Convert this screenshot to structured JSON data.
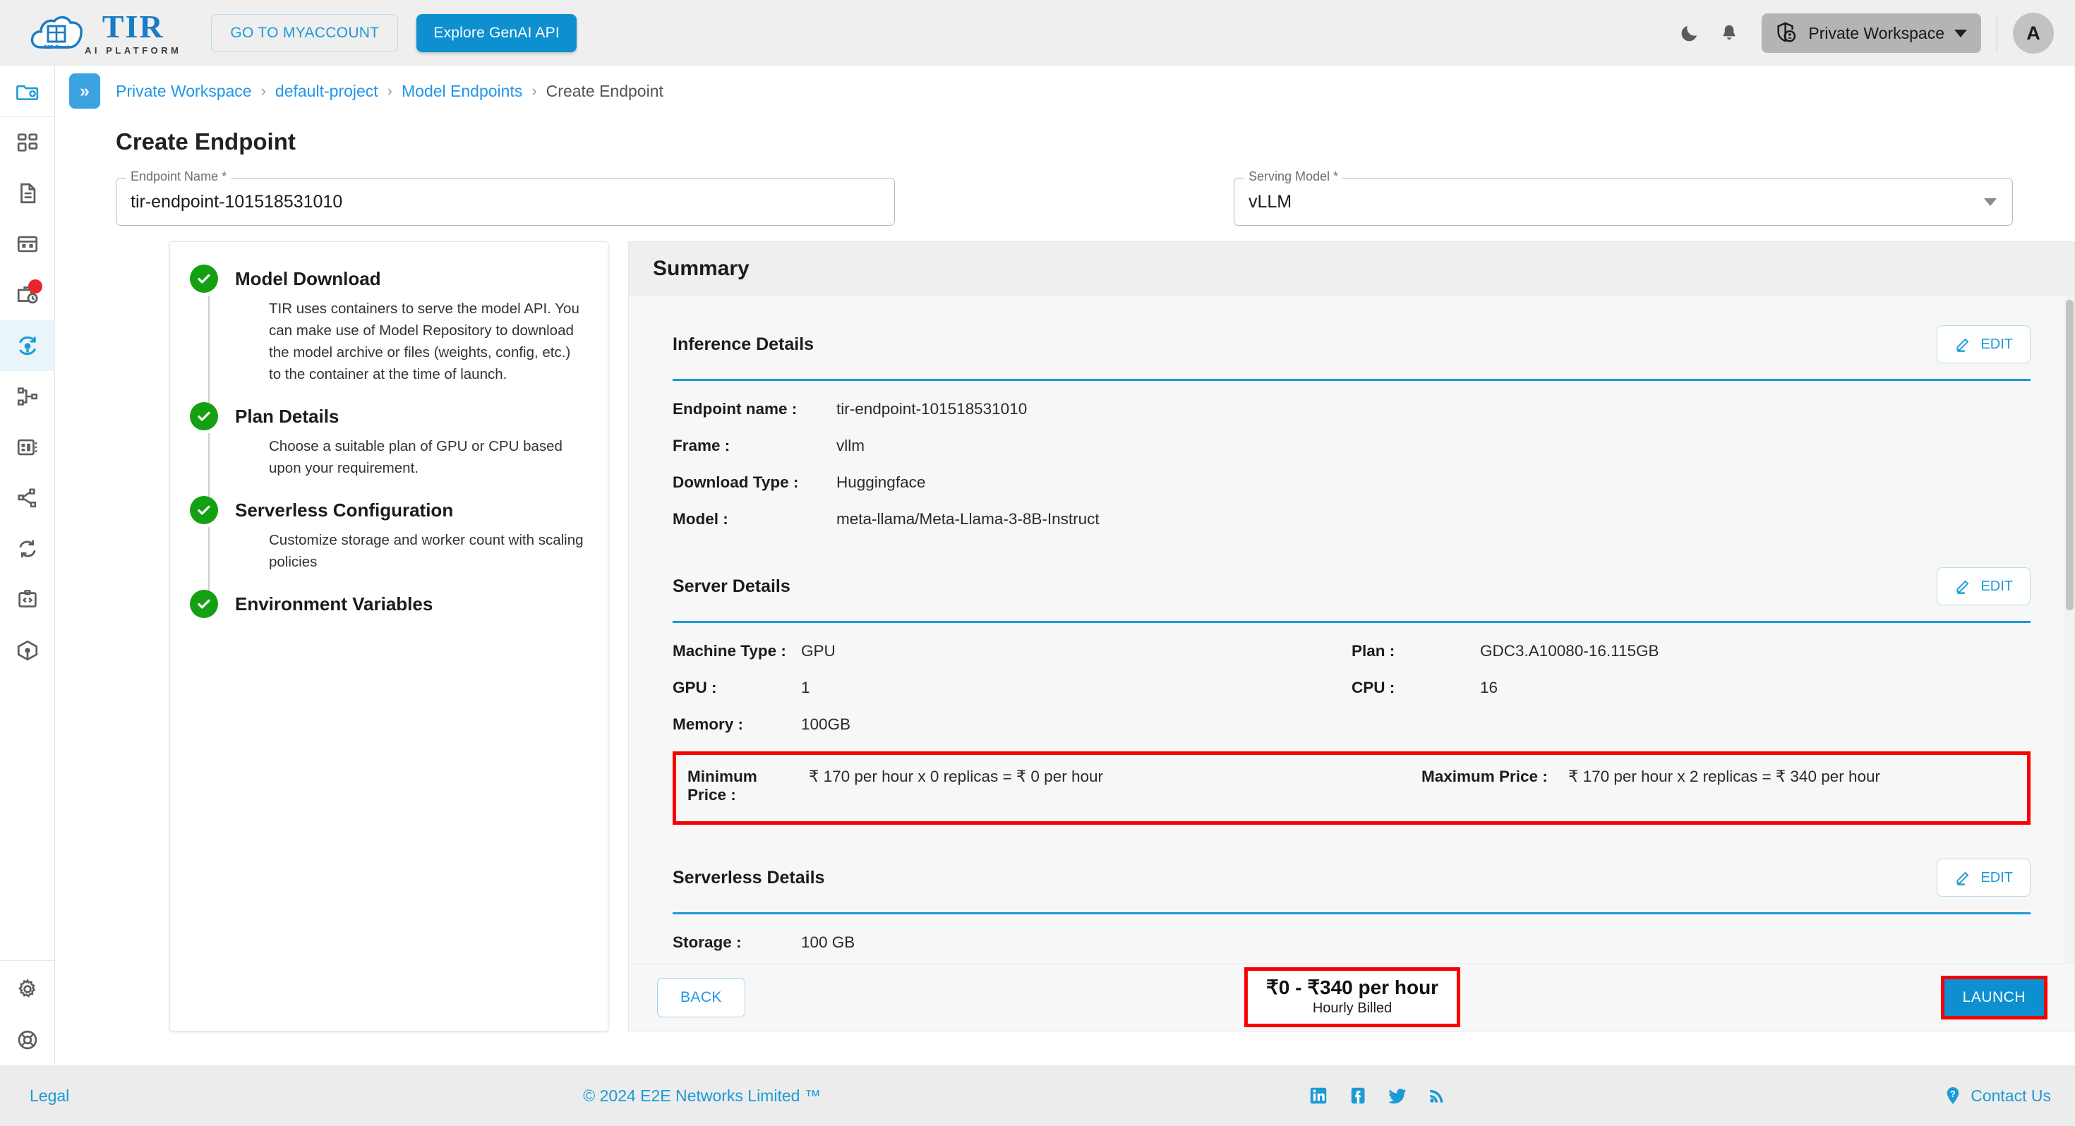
{
  "brand": {
    "logo_title": "TIR",
    "logo_subtitle": "AI PLATFORM",
    "logo_badge": "E2E Cloud",
    "accent_blue": "#0d8fd0",
    "link_blue": "#2196e8",
    "success_green": "#14a013",
    "highlight_red": "#f90000"
  },
  "topbar": {
    "myaccount_label": "GO TO MYACCOUNT",
    "genai_label": "Explore GenAI API",
    "dark_mode_icon": "moon-icon",
    "notifications_icon": "bell-icon",
    "workspace_label": "Private Workspace",
    "workspace_icon": "shield-user-icon",
    "avatar_initial": "A"
  },
  "sidebar": {
    "top_action_icon": "folder-add-icon",
    "items": [
      {
        "name": "dashboard",
        "icon": "dashboard-grid-icon",
        "active": false,
        "badge": false
      },
      {
        "name": "notebooks",
        "icon": "document-icon",
        "active": false,
        "badge": false
      },
      {
        "name": "datasets",
        "icon": "table-grid-icon",
        "active": false,
        "badge": false
      },
      {
        "name": "jobs",
        "icon": "briefcase-clock-icon",
        "active": false,
        "badge": true
      },
      {
        "name": "model-endpoints",
        "icon": "endpoint-refresh-icon",
        "active": true,
        "badge": false
      },
      {
        "name": "pipelines",
        "icon": "pipeline-nodes-icon",
        "active": false,
        "badge": false
      },
      {
        "name": "model-repository",
        "icon": "repository-icon",
        "active": false,
        "badge": false
      },
      {
        "name": "distributions",
        "icon": "share-nodes-icon",
        "active": false,
        "badge": false
      },
      {
        "name": "sync",
        "icon": "sync-arrows-icon",
        "active": false,
        "badge": false
      },
      {
        "name": "code",
        "icon": "code-board-icon",
        "active": false,
        "badge": false
      },
      {
        "name": "containers",
        "icon": "cube-icon",
        "active": false,
        "badge": false
      }
    ],
    "bottom_items": [
      {
        "name": "settings",
        "icon": "gear-icon"
      },
      {
        "name": "support",
        "icon": "lifebuoy-icon"
      }
    ]
  },
  "breadcrumb": {
    "collapse_icon": "chevron-double-right-icon",
    "items": [
      {
        "label": "Private Workspace",
        "link": true
      },
      {
        "label": "default-project",
        "link": true
      },
      {
        "label": "Model Endpoints",
        "link": true
      },
      {
        "label": "Create Endpoint",
        "link": false
      }
    ],
    "separator": "›"
  },
  "page": {
    "title": "Create Endpoint"
  },
  "form": {
    "endpoint_name": {
      "label": "Endpoint Name *",
      "value": "tir-endpoint-101518531010"
    },
    "serving_model": {
      "label": "Serving Model *",
      "value": "vLLM",
      "caret_icon": "chevron-down-icon"
    }
  },
  "stepper": {
    "steps": [
      {
        "title": "Model Download",
        "desc": "TIR uses containers to serve the model API. You can make use of Model Repository to download the model archive or files (weights, config, etc.) to the container at the time of launch.",
        "status_icon": "check-circle-icon"
      },
      {
        "title": "Plan Details",
        "desc": "Choose a suitable plan of GPU or CPU based upon your requirement.",
        "status_icon": "check-circle-icon"
      },
      {
        "title": "Serverless Configuration",
        "desc": "Customize storage and worker count with scaling policies",
        "status_icon": "check-circle-icon"
      },
      {
        "title": "Environment Variables",
        "desc": "",
        "status_icon": "check-circle-icon"
      }
    ]
  },
  "summary": {
    "heading": "Summary",
    "edit_label": "EDIT",
    "edit_icon": "pencil-icon",
    "sections": [
      {
        "name": "inference-details",
        "title": "Inference Details",
        "rows": [
          {
            "key": "Endpoint name :",
            "value": "tir-endpoint-101518531010"
          },
          {
            "key": "Frame :",
            "value": "vllm"
          },
          {
            "key": "Download Type :",
            "value": "Huggingface"
          },
          {
            "key": "Model :",
            "value": "meta-llama/Meta-Llama-3-8B-Instruct"
          }
        ]
      },
      {
        "name": "server-details",
        "title": "Server Details",
        "rows": [
          {
            "key": "Machine Type :",
            "value": "GPU"
          },
          {
            "key": "Plan :",
            "value": "GDC3.A10080-16.115GB"
          },
          {
            "key": "GPU :",
            "value": "1"
          },
          {
            "key": "CPU :",
            "value": "16"
          },
          {
            "key": "Memory :",
            "value": "100GB"
          }
        ],
        "price_highlight": {
          "min_key": "Minimum Price :",
          "min_value": "₹ 170 per hour x 0 replicas = ₹ 0 per hour",
          "max_key": "Maximum Price :",
          "max_value": "₹ 170 per hour x 2 replicas = ₹ 340 per hour"
        }
      },
      {
        "name": "serverless-details",
        "title": "Serverless Details",
        "rows": [
          {
            "key": "Storage :",
            "value": "100 GB"
          }
        ]
      }
    ]
  },
  "footer_bar": {
    "back_label": "BACK",
    "price_range": "₹0 - ₹340 per hour",
    "billing_note": "Hourly Billed",
    "launch_label": "LAUNCH"
  },
  "page_footer": {
    "legal_label": "Legal",
    "copyright": "© 2024 E2E Networks Limited ™",
    "social": [
      {
        "name": "linkedin-icon"
      },
      {
        "name": "facebook-icon"
      },
      {
        "name": "twitter-icon"
      },
      {
        "name": "rss-icon"
      }
    ],
    "contact_label": "Contact Us",
    "contact_icon": "question-pin-icon"
  }
}
